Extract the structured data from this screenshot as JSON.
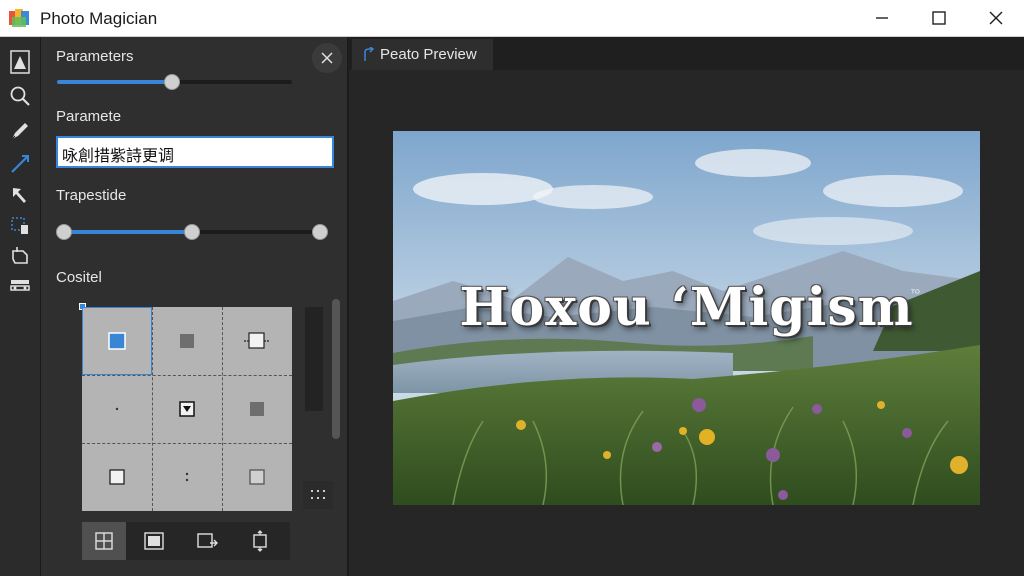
{
  "window": {
    "title": "Photo Magician",
    "controls": [
      "minimize",
      "maximize",
      "close"
    ]
  },
  "tools": [
    "image-icon",
    "zoom-icon",
    "pen-icon",
    "line-icon",
    "arrow-icon",
    "transform-icon",
    "crop-icon",
    "layers-icon"
  ],
  "panel": {
    "parameters_label": "Parameters",
    "parameters_slider_value": 0.49,
    "text_label": "Paramete",
    "text_value": "咏創措紫詩更调",
    "trapezoid_label": "Trapestide",
    "trapezoid_range_low": 0.0,
    "trapezoid_range_high": 0.5,
    "trapezoid_range_end": 1.0,
    "cosite_label": "Cositel"
  },
  "preview": {
    "tab_label": "Peato Preview",
    "overlay_title": "Hoxou ‘Migism",
    "overlay_mark": "ᵀᴼ"
  },
  "colors": {
    "accent": "#3a86d6",
    "panel_bg": "#2f2f2f",
    "title_bar_bg": "#ffffff"
  }
}
